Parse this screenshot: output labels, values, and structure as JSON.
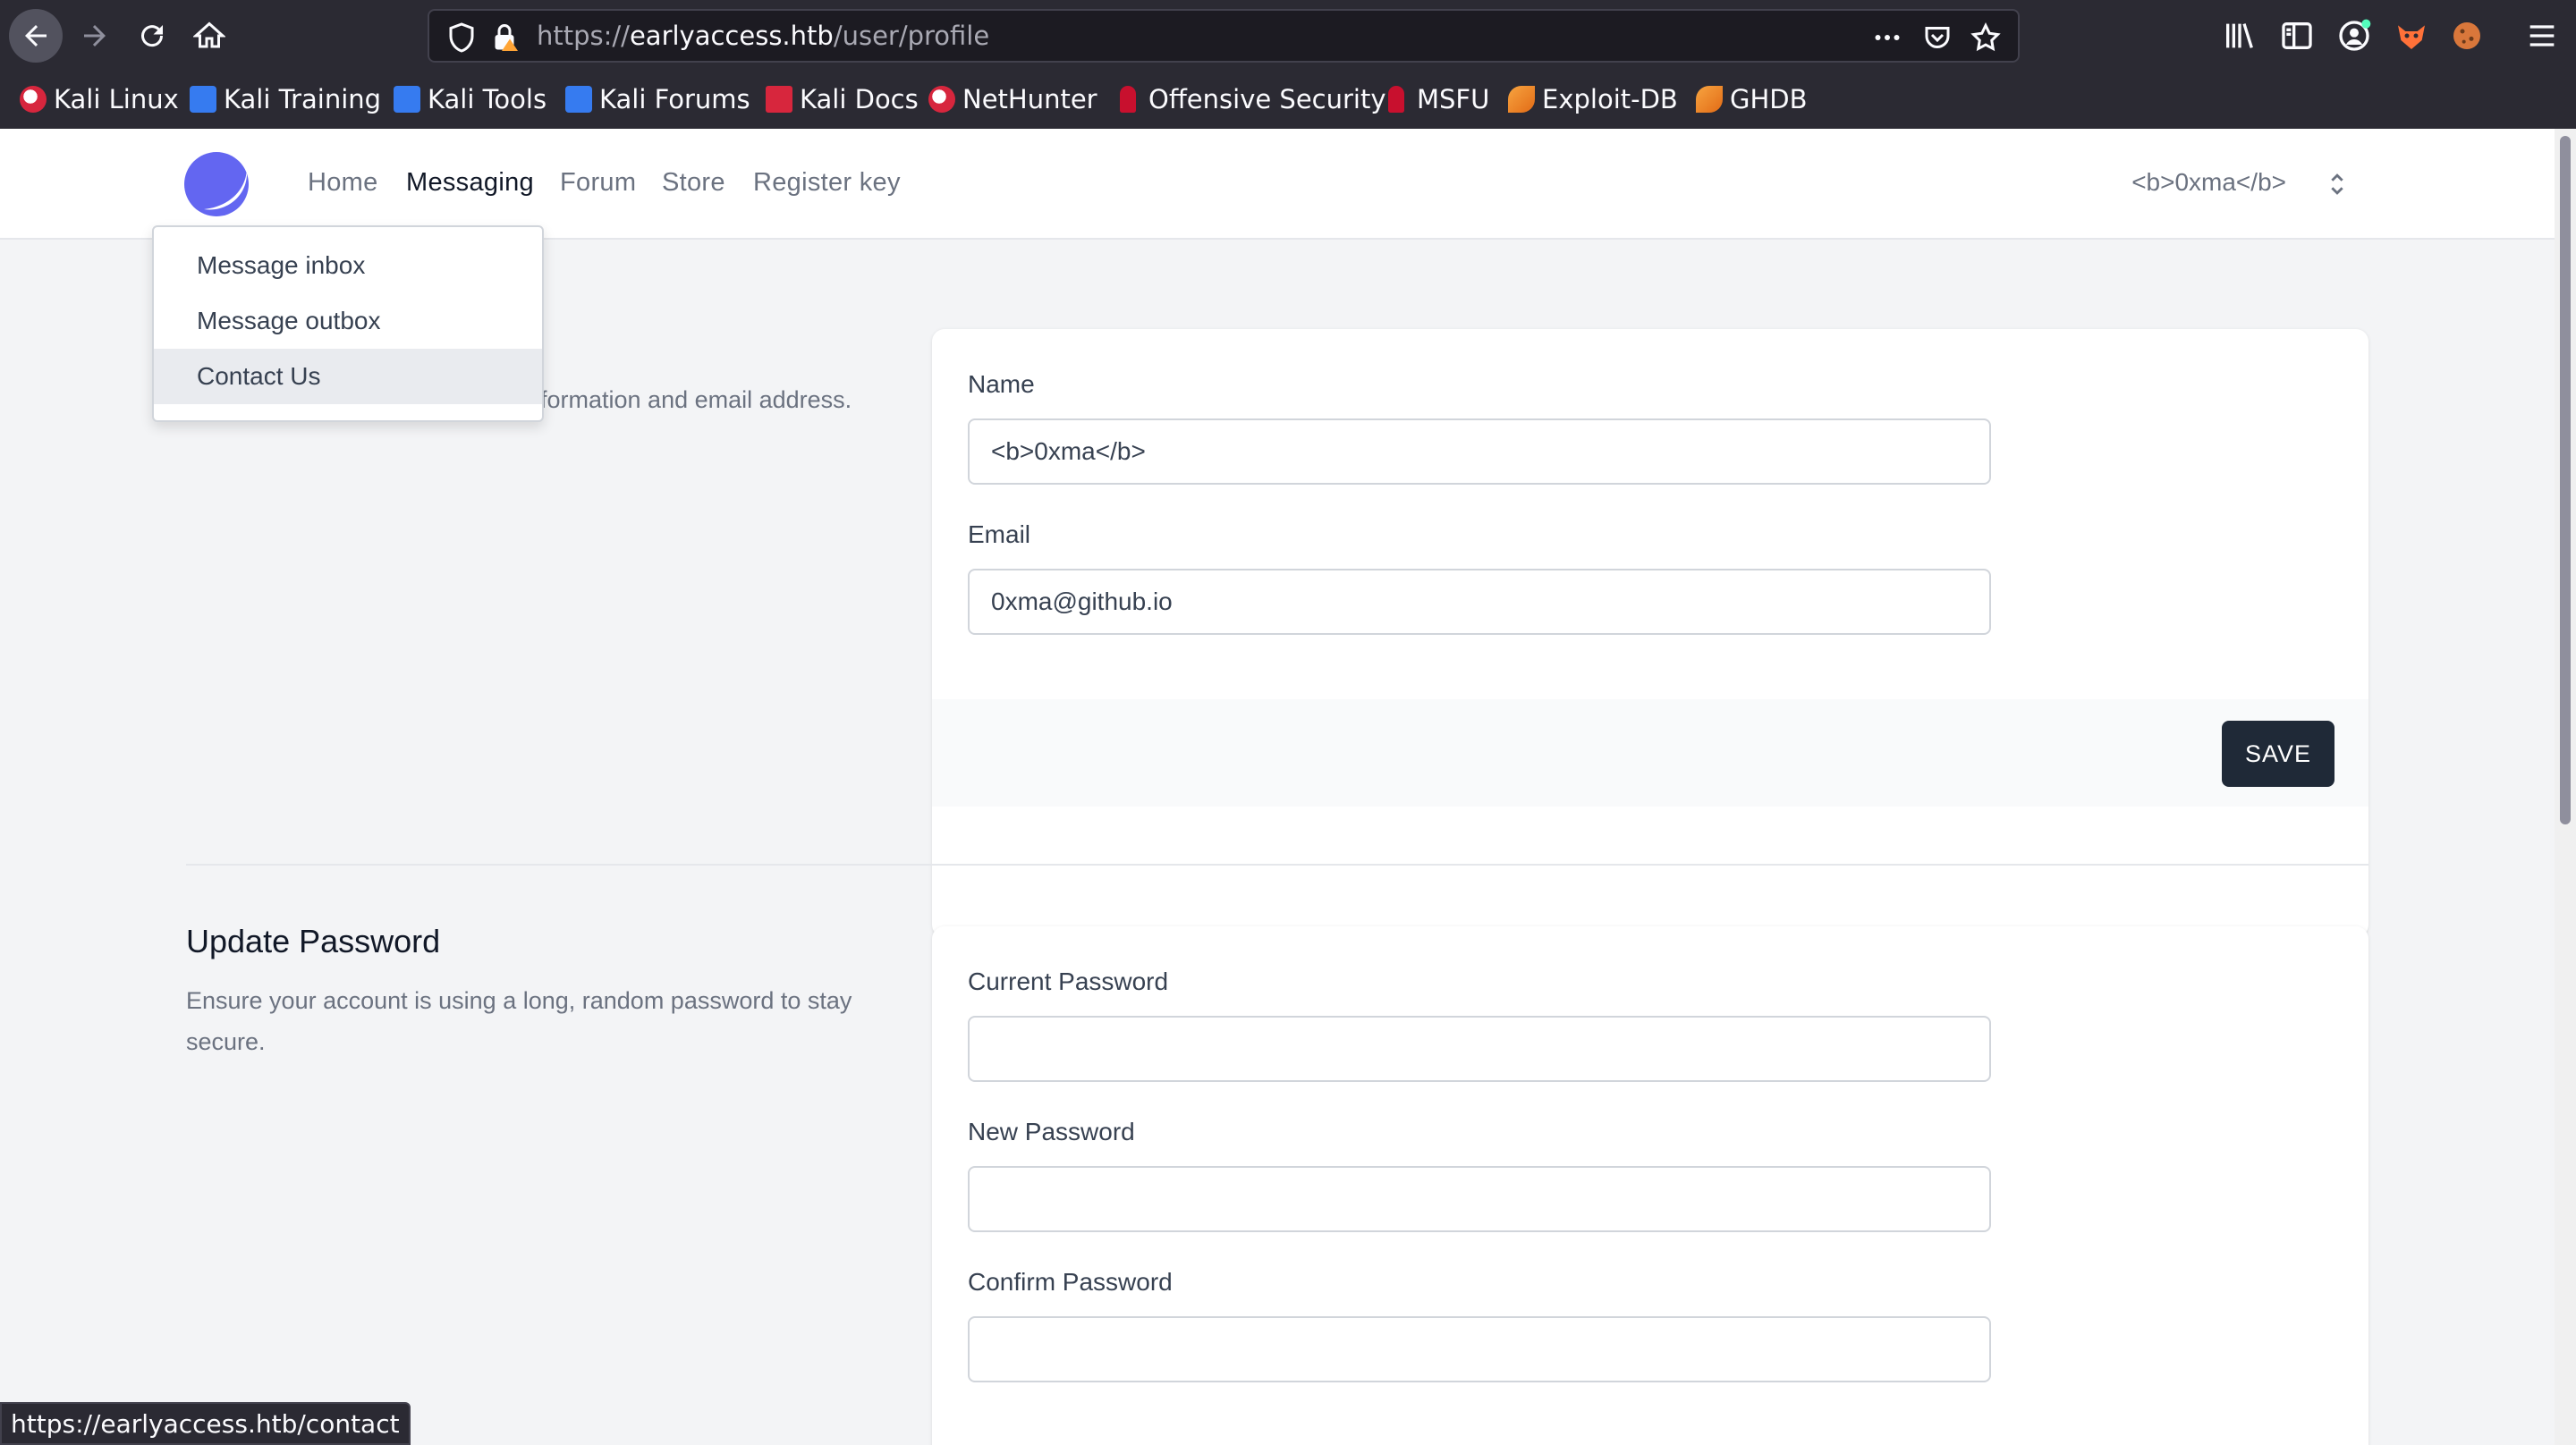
{
  "browser": {
    "url_scheme": "https://",
    "url_host": "earlyaccess.htb",
    "url_path": "/user/profile",
    "bookmarks": [
      {
        "label": "Kali Linux",
        "icon": "kali-dragon-icon"
      },
      {
        "label": "Kali Training",
        "icon": "kali-training-icon"
      },
      {
        "label": "Kali Tools",
        "icon": "kali-tools-icon"
      },
      {
        "label": "Kali Forums",
        "icon": "kali-forums-icon"
      },
      {
        "label": "Kali Docs",
        "icon": "kali-docs-icon"
      },
      {
        "label": "NetHunter",
        "icon": "nethunter-icon"
      },
      {
        "label": "Offensive Security",
        "icon": "offsec-icon"
      },
      {
        "label": "MSFU",
        "icon": "msfu-icon"
      },
      {
        "label": "Exploit-DB",
        "icon": "exploit-db-icon"
      },
      {
        "label": "GHDB",
        "icon": "ghdb-icon"
      }
    ],
    "status_url": "https://earlyaccess.htb/contact"
  },
  "nav": {
    "links": [
      "Home",
      "Messaging",
      "Forum",
      "Store",
      "Register key"
    ],
    "active": "Messaging",
    "user_name": "<b>0xma</b>"
  },
  "dropdown": {
    "items": [
      "Message inbox",
      "Message outbox",
      "Contact Us"
    ],
    "hovered": "Contact Us"
  },
  "profile": {
    "desc_visible": "formation and email address.",
    "name_label": "Name",
    "name_value": "<b>0xma</b>",
    "email_label": "Email",
    "email_value": "0xma@github.io",
    "save_label": "SAVE"
  },
  "password": {
    "title": "Update Password",
    "desc_line1": "Ensure your account is using a long, random password to stay",
    "desc_line2": "secure.",
    "current_label": "Current Password",
    "new_label": "New Password",
    "confirm_label": "Confirm Password"
  },
  "colors": {
    "chrome_bg": "#2b2a33",
    "logo": "#6366f1",
    "save_button": "#1f2937"
  }
}
